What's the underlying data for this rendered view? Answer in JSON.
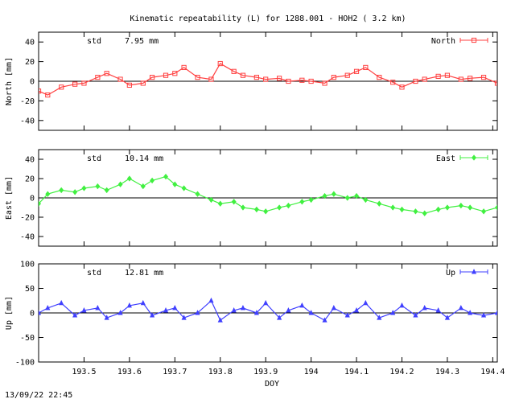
{
  "chart_data": {
    "type": "scatter",
    "title": "Kinematic repeatability (L) for 1288.001 - HOH2  (  3.2 km)",
    "xlabel": "DOY",
    "timestamp": "13/09/22 22:45",
    "xlim": [
      193.4,
      194.41
    ],
    "x_ticks": [
      193.5,
      193.6,
      193.7,
      193.8,
      193.9,
      194.0,
      194.1,
      194.2,
      194.3,
      194.4
    ],
    "x_tick_labels": [
      "193.5",
      "193.6",
      "193.7",
      "193.8",
      "193.9",
      "194",
      "194.1",
      "194.2",
      "194.3",
      "194.4"
    ],
    "panels": [
      {
        "name": "North",
        "ylabel": "North [mm]",
        "ylim": [
          -50,
          50
        ],
        "y_ticks": [
          -40,
          -20,
          0,
          20,
          40
        ],
        "y_tick_labels": [
          "-40",
          "-20",
          "0",
          "20",
          "40"
        ],
        "std_label": "std",
        "std_value": "7.95 mm",
        "legend": "North",
        "color": "#ff4040",
        "marker": "square",
        "x": [
          193.4,
          193.42,
          193.45,
          193.48,
          193.5,
          193.53,
          193.55,
          193.58,
          193.6,
          193.63,
          193.65,
          193.68,
          193.7,
          193.72,
          193.75,
          193.78,
          193.8,
          193.83,
          193.85,
          193.88,
          193.9,
          193.93,
          193.95,
          193.98,
          194.0,
          194.03,
          194.05,
          194.08,
          194.1,
          194.12,
          194.15,
          194.18,
          194.2,
          194.23,
          194.25,
          194.28,
          194.3,
          194.33,
          194.35,
          194.38,
          194.41
        ],
        "values": [
          -10,
          -14,
          -6,
          -3,
          -2,
          4,
          8,
          2,
          -4,
          -2,
          4,
          6,
          8,
          14,
          4,
          2,
          18,
          10,
          6,
          4,
          2,
          3,
          0,
          1,
          0,
          -2,
          4,
          6,
          10,
          14,
          4,
          -1,
          -6,
          0,
          2,
          5,
          6,
          2,
          3,
          4,
          -2
        ]
      },
      {
        "name": "East",
        "ylabel": "East [mm]",
        "ylim": [
          -50,
          50
        ],
        "y_ticks": [
          -40,
          -20,
          0,
          20,
          40
        ],
        "y_tick_labels": [
          "-40",
          "-20",
          "0",
          "20",
          "40"
        ],
        "std_label": "std",
        "std_value": "10.14 mm",
        "legend": "East",
        "color": "#40f040",
        "marker": "diamond",
        "x": [
          193.4,
          193.42,
          193.45,
          193.48,
          193.5,
          193.53,
          193.55,
          193.58,
          193.6,
          193.63,
          193.65,
          193.68,
          193.7,
          193.72,
          193.75,
          193.78,
          193.8,
          193.83,
          193.85,
          193.88,
          193.9,
          193.93,
          193.95,
          193.98,
          194.0,
          194.03,
          194.05,
          194.08,
          194.1,
          194.12,
          194.15,
          194.18,
          194.2,
          194.23,
          194.25,
          194.28,
          194.3,
          194.33,
          194.35,
          194.38,
          194.41
        ],
        "values": [
          -6,
          4,
          8,
          6,
          10,
          12,
          8,
          14,
          20,
          12,
          18,
          22,
          14,
          10,
          4,
          -2,
          -6,
          -4,
          -10,
          -12,
          -14,
          -10,
          -8,
          -4,
          -2,
          2,
          4,
          0,
          2,
          -2,
          -6,
          -10,
          -12,
          -14,
          -16,
          -12,
          -10,
          -8,
          -10,
          -14,
          -10
        ]
      },
      {
        "name": "Up",
        "ylabel": "Up [mm]",
        "ylim": [
          -100,
          100
        ],
        "y_ticks": [
          -100,
          -50,
          0,
          50,
          100
        ],
        "y_tick_labels": [
          "-100",
          "-50",
          "0",
          "50",
          "100"
        ],
        "std_label": "std",
        "std_value": "12.81 mm",
        "legend": "Up",
        "color": "#4040ff",
        "marker": "triangle",
        "x": [
          193.4,
          193.42,
          193.45,
          193.48,
          193.5,
          193.53,
          193.55,
          193.58,
          193.6,
          193.63,
          193.65,
          193.68,
          193.7,
          193.72,
          193.75,
          193.78,
          193.8,
          193.83,
          193.85,
          193.88,
          193.9,
          193.93,
          193.95,
          193.98,
          194.0,
          194.03,
          194.05,
          194.08,
          194.1,
          194.12,
          194.15,
          194.18,
          194.2,
          194.23,
          194.25,
          194.28,
          194.3,
          194.33,
          194.35,
          194.38,
          194.41
        ],
        "values": [
          0,
          10,
          20,
          -5,
          5,
          10,
          -10,
          0,
          15,
          20,
          -5,
          5,
          10,
          -10,
          0,
          25,
          -15,
          5,
          10,
          0,
          20,
          -10,
          5,
          15,
          0,
          -15,
          10,
          -5,
          5,
          20,
          -10,
          0,
          15,
          -5,
          10,
          5,
          -10,
          10,
          0,
          -5,
          0
        ]
      }
    ]
  }
}
